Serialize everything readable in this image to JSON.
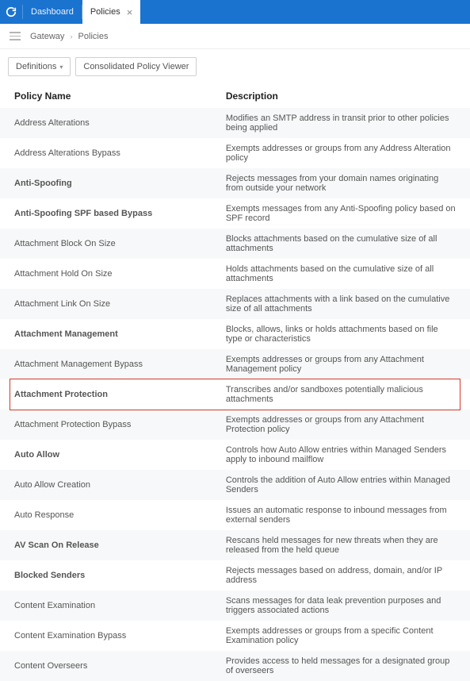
{
  "topbar": {
    "tabs": [
      {
        "label": "Dashboard",
        "active": false
      },
      {
        "label": "Policies",
        "active": true
      }
    ]
  },
  "breadcrumb": {
    "part1": "Gateway",
    "part2": "Policies"
  },
  "toolbar": {
    "definitions_label": "Definitions",
    "viewer_label": "Consolidated Policy Viewer"
  },
  "table": {
    "headers": {
      "name": "Policy Name",
      "description": "Description"
    },
    "rows": [
      {
        "name": "Address Alterations",
        "desc": "Modifies an SMTP address in transit prior to other policies being applied",
        "bold": false
      },
      {
        "name": "Address Alterations Bypass",
        "desc": "Exempts addresses or groups from any Address Alteration policy",
        "bold": false
      },
      {
        "name": "Anti-Spoofing",
        "desc": "Rejects messages from your domain names originating from outside your network",
        "bold": true
      },
      {
        "name": "Anti-Spoofing SPF based Bypass",
        "desc": "Exempts messages from any Anti-Spoofing policy based on SPF record",
        "bold": true
      },
      {
        "name": "Attachment Block On Size",
        "desc": "Blocks attachments based on the cumulative size of all attachments",
        "bold": false
      },
      {
        "name": "Attachment Hold On Size",
        "desc": "Holds attachments based on the cumulative size of all attachments",
        "bold": false
      },
      {
        "name": "Attachment Link On Size",
        "desc": "Replaces attachments with a link based on the cumulative size of all attachments",
        "bold": false
      },
      {
        "name": "Attachment Management",
        "desc": "Blocks, allows, links or holds attachments based on file type or characteristics",
        "bold": true
      },
      {
        "name": "Attachment Management Bypass",
        "desc": "Exempts addresses or groups from any Attachment Management policy",
        "bold": false
      },
      {
        "name": "Attachment Protection",
        "desc": "Transcribes and/or sandboxes potentially malicious attachments",
        "bold": true,
        "highlight": true
      },
      {
        "name": "Attachment Protection Bypass",
        "desc": "Exempts addresses or groups from any Attachment Protection policy",
        "bold": false
      },
      {
        "name": "Auto Allow",
        "desc": "Controls how Auto Allow entries within Managed Senders apply to inbound mailflow",
        "bold": true
      },
      {
        "name": "Auto Allow Creation",
        "desc": "Controls the addition of Auto Allow entries within Managed Senders",
        "bold": false
      },
      {
        "name": "Auto Response",
        "desc": "Issues an automatic response to inbound messages from external senders",
        "bold": false
      },
      {
        "name": "AV Scan On Release",
        "desc": "Rescans held messages for new threats when they are released from the held queue",
        "bold": true
      },
      {
        "name": "Blocked Senders",
        "desc": "Rejects messages based on address, domain, and/or IP address",
        "bold": true
      },
      {
        "name": "Content Examination",
        "desc": "Scans messages for data leak prevention purposes and triggers associated actions",
        "bold": false
      },
      {
        "name": "Content Examination Bypass",
        "desc": "Exempts addresses or groups from a specific Content Examination policy",
        "bold": false
      },
      {
        "name": "Content Overseers",
        "desc": "Provides access to held messages for a designated group of overseers",
        "bold": false
      }
    ]
  }
}
